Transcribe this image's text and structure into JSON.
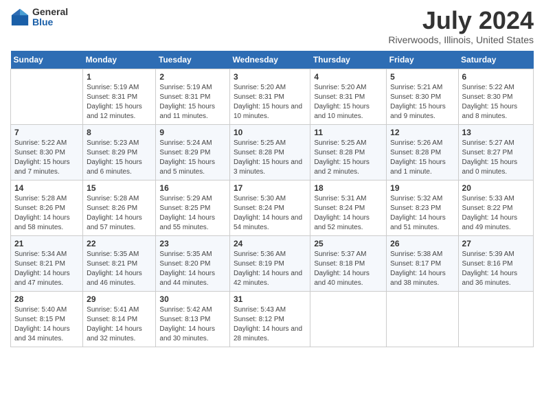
{
  "logo": {
    "general": "General",
    "blue": "Blue"
  },
  "title": "July 2024",
  "subtitle": "Riverwoods, Illinois, United States",
  "days_of_week": [
    "Sunday",
    "Monday",
    "Tuesday",
    "Wednesday",
    "Thursday",
    "Friday",
    "Saturday"
  ],
  "weeks": [
    [
      {
        "day": "",
        "info": ""
      },
      {
        "day": "1",
        "info": "Sunrise: 5:19 AM\nSunset: 8:31 PM\nDaylight: 15 hours and 12 minutes."
      },
      {
        "day": "2",
        "info": "Sunrise: 5:19 AM\nSunset: 8:31 PM\nDaylight: 15 hours and 11 minutes."
      },
      {
        "day": "3",
        "info": "Sunrise: 5:20 AM\nSunset: 8:31 PM\nDaylight: 15 hours and 10 minutes."
      },
      {
        "day": "4",
        "info": "Sunrise: 5:20 AM\nSunset: 8:31 PM\nDaylight: 15 hours and 10 minutes."
      },
      {
        "day": "5",
        "info": "Sunrise: 5:21 AM\nSunset: 8:30 PM\nDaylight: 15 hours and 9 minutes."
      },
      {
        "day": "6",
        "info": "Sunrise: 5:22 AM\nSunset: 8:30 PM\nDaylight: 15 hours and 8 minutes."
      }
    ],
    [
      {
        "day": "7",
        "info": "Sunrise: 5:22 AM\nSunset: 8:30 PM\nDaylight: 15 hours and 7 minutes."
      },
      {
        "day": "8",
        "info": "Sunrise: 5:23 AM\nSunset: 8:29 PM\nDaylight: 15 hours and 6 minutes."
      },
      {
        "day": "9",
        "info": "Sunrise: 5:24 AM\nSunset: 8:29 PM\nDaylight: 15 hours and 5 minutes."
      },
      {
        "day": "10",
        "info": "Sunrise: 5:25 AM\nSunset: 8:28 PM\nDaylight: 15 hours and 3 minutes."
      },
      {
        "day": "11",
        "info": "Sunrise: 5:25 AM\nSunset: 8:28 PM\nDaylight: 15 hours and 2 minutes."
      },
      {
        "day": "12",
        "info": "Sunrise: 5:26 AM\nSunset: 8:28 PM\nDaylight: 15 hours and 1 minute."
      },
      {
        "day": "13",
        "info": "Sunrise: 5:27 AM\nSunset: 8:27 PM\nDaylight: 15 hours and 0 minutes."
      }
    ],
    [
      {
        "day": "14",
        "info": "Sunrise: 5:28 AM\nSunset: 8:26 PM\nDaylight: 14 hours and 58 minutes."
      },
      {
        "day": "15",
        "info": "Sunrise: 5:28 AM\nSunset: 8:26 PM\nDaylight: 14 hours and 57 minutes."
      },
      {
        "day": "16",
        "info": "Sunrise: 5:29 AM\nSunset: 8:25 PM\nDaylight: 14 hours and 55 minutes."
      },
      {
        "day": "17",
        "info": "Sunrise: 5:30 AM\nSunset: 8:24 PM\nDaylight: 14 hours and 54 minutes."
      },
      {
        "day": "18",
        "info": "Sunrise: 5:31 AM\nSunset: 8:24 PM\nDaylight: 14 hours and 52 minutes."
      },
      {
        "day": "19",
        "info": "Sunrise: 5:32 AM\nSunset: 8:23 PM\nDaylight: 14 hours and 51 minutes."
      },
      {
        "day": "20",
        "info": "Sunrise: 5:33 AM\nSunset: 8:22 PM\nDaylight: 14 hours and 49 minutes."
      }
    ],
    [
      {
        "day": "21",
        "info": "Sunrise: 5:34 AM\nSunset: 8:21 PM\nDaylight: 14 hours and 47 minutes."
      },
      {
        "day": "22",
        "info": "Sunrise: 5:35 AM\nSunset: 8:21 PM\nDaylight: 14 hours and 46 minutes."
      },
      {
        "day": "23",
        "info": "Sunrise: 5:35 AM\nSunset: 8:20 PM\nDaylight: 14 hours and 44 minutes."
      },
      {
        "day": "24",
        "info": "Sunrise: 5:36 AM\nSunset: 8:19 PM\nDaylight: 14 hours and 42 minutes."
      },
      {
        "day": "25",
        "info": "Sunrise: 5:37 AM\nSunset: 8:18 PM\nDaylight: 14 hours and 40 minutes."
      },
      {
        "day": "26",
        "info": "Sunrise: 5:38 AM\nSunset: 8:17 PM\nDaylight: 14 hours and 38 minutes."
      },
      {
        "day": "27",
        "info": "Sunrise: 5:39 AM\nSunset: 8:16 PM\nDaylight: 14 hours and 36 minutes."
      }
    ],
    [
      {
        "day": "28",
        "info": "Sunrise: 5:40 AM\nSunset: 8:15 PM\nDaylight: 14 hours and 34 minutes."
      },
      {
        "day": "29",
        "info": "Sunrise: 5:41 AM\nSunset: 8:14 PM\nDaylight: 14 hours and 32 minutes."
      },
      {
        "day": "30",
        "info": "Sunrise: 5:42 AM\nSunset: 8:13 PM\nDaylight: 14 hours and 30 minutes."
      },
      {
        "day": "31",
        "info": "Sunrise: 5:43 AM\nSunset: 8:12 PM\nDaylight: 14 hours and 28 minutes."
      },
      {
        "day": "",
        "info": ""
      },
      {
        "day": "",
        "info": ""
      },
      {
        "day": "",
        "info": ""
      }
    ]
  ]
}
